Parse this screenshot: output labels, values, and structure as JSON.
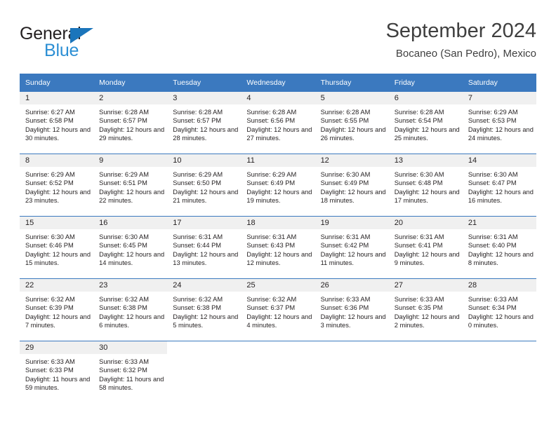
{
  "brand": {
    "name_top": "General",
    "name_bottom": "Blue"
  },
  "header": {
    "title": "September 2024",
    "subtitle": "Bocaneo (San Pedro), Mexico"
  },
  "colors": {
    "header_blue": "#3b79bf",
    "brand_blue": "#1b75bb",
    "brand_blue_light": "#2c8fd4",
    "day_band": "#f0f0f0",
    "text": "#231f20"
  },
  "weekdays": [
    "Sunday",
    "Monday",
    "Tuesday",
    "Wednesday",
    "Thursday",
    "Friday",
    "Saturday"
  ],
  "labels": {
    "sunrise_prefix": "Sunrise:",
    "sunset_prefix": "Sunset:",
    "daylight_prefix": "Daylight:"
  },
  "weeks": [
    [
      {
        "day": "1",
        "sunrise": "Sunrise: 6:27 AM",
        "sunset": "Sunset: 6:58 PM",
        "daylight": "Daylight: 12 hours and 30 minutes."
      },
      {
        "day": "2",
        "sunrise": "Sunrise: 6:28 AM",
        "sunset": "Sunset: 6:57 PM",
        "daylight": "Daylight: 12 hours and 29 minutes."
      },
      {
        "day": "3",
        "sunrise": "Sunrise: 6:28 AM",
        "sunset": "Sunset: 6:57 PM",
        "daylight": "Daylight: 12 hours and 28 minutes."
      },
      {
        "day": "4",
        "sunrise": "Sunrise: 6:28 AM",
        "sunset": "Sunset: 6:56 PM",
        "daylight": "Daylight: 12 hours and 27 minutes."
      },
      {
        "day": "5",
        "sunrise": "Sunrise: 6:28 AM",
        "sunset": "Sunset: 6:55 PM",
        "daylight": "Daylight: 12 hours and 26 minutes."
      },
      {
        "day": "6",
        "sunrise": "Sunrise: 6:28 AM",
        "sunset": "Sunset: 6:54 PM",
        "daylight": "Daylight: 12 hours and 25 minutes."
      },
      {
        "day": "7",
        "sunrise": "Sunrise: 6:29 AM",
        "sunset": "Sunset: 6:53 PM",
        "daylight": "Daylight: 12 hours and 24 minutes."
      }
    ],
    [
      {
        "day": "8",
        "sunrise": "Sunrise: 6:29 AM",
        "sunset": "Sunset: 6:52 PM",
        "daylight": "Daylight: 12 hours and 23 minutes."
      },
      {
        "day": "9",
        "sunrise": "Sunrise: 6:29 AM",
        "sunset": "Sunset: 6:51 PM",
        "daylight": "Daylight: 12 hours and 22 minutes."
      },
      {
        "day": "10",
        "sunrise": "Sunrise: 6:29 AM",
        "sunset": "Sunset: 6:50 PM",
        "daylight": "Daylight: 12 hours and 21 minutes."
      },
      {
        "day": "11",
        "sunrise": "Sunrise: 6:29 AM",
        "sunset": "Sunset: 6:49 PM",
        "daylight": "Daylight: 12 hours and 19 minutes."
      },
      {
        "day": "12",
        "sunrise": "Sunrise: 6:30 AM",
        "sunset": "Sunset: 6:49 PM",
        "daylight": "Daylight: 12 hours and 18 minutes."
      },
      {
        "day": "13",
        "sunrise": "Sunrise: 6:30 AM",
        "sunset": "Sunset: 6:48 PM",
        "daylight": "Daylight: 12 hours and 17 minutes."
      },
      {
        "day": "14",
        "sunrise": "Sunrise: 6:30 AM",
        "sunset": "Sunset: 6:47 PM",
        "daylight": "Daylight: 12 hours and 16 minutes."
      }
    ],
    [
      {
        "day": "15",
        "sunrise": "Sunrise: 6:30 AM",
        "sunset": "Sunset: 6:46 PM",
        "daylight": "Daylight: 12 hours and 15 minutes."
      },
      {
        "day": "16",
        "sunrise": "Sunrise: 6:30 AM",
        "sunset": "Sunset: 6:45 PM",
        "daylight": "Daylight: 12 hours and 14 minutes."
      },
      {
        "day": "17",
        "sunrise": "Sunrise: 6:31 AM",
        "sunset": "Sunset: 6:44 PM",
        "daylight": "Daylight: 12 hours and 13 minutes."
      },
      {
        "day": "18",
        "sunrise": "Sunrise: 6:31 AM",
        "sunset": "Sunset: 6:43 PM",
        "daylight": "Daylight: 12 hours and 12 minutes."
      },
      {
        "day": "19",
        "sunrise": "Sunrise: 6:31 AM",
        "sunset": "Sunset: 6:42 PM",
        "daylight": "Daylight: 12 hours and 11 minutes."
      },
      {
        "day": "20",
        "sunrise": "Sunrise: 6:31 AM",
        "sunset": "Sunset: 6:41 PM",
        "daylight": "Daylight: 12 hours and 9 minutes."
      },
      {
        "day": "21",
        "sunrise": "Sunrise: 6:31 AM",
        "sunset": "Sunset: 6:40 PM",
        "daylight": "Daylight: 12 hours and 8 minutes."
      }
    ],
    [
      {
        "day": "22",
        "sunrise": "Sunrise: 6:32 AM",
        "sunset": "Sunset: 6:39 PM",
        "daylight": "Daylight: 12 hours and 7 minutes."
      },
      {
        "day": "23",
        "sunrise": "Sunrise: 6:32 AM",
        "sunset": "Sunset: 6:38 PM",
        "daylight": "Daylight: 12 hours and 6 minutes."
      },
      {
        "day": "24",
        "sunrise": "Sunrise: 6:32 AM",
        "sunset": "Sunset: 6:38 PM",
        "daylight": "Daylight: 12 hours and 5 minutes."
      },
      {
        "day": "25",
        "sunrise": "Sunrise: 6:32 AM",
        "sunset": "Sunset: 6:37 PM",
        "daylight": "Daylight: 12 hours and 4 minutes."
      },
      {
        "day": "26",
        "sunrise": "Sunrise: 6:33 AM",
        "sunset": "Sunset: 6:36 PM",
        "daylight": "Daylight: 12 hours and 3 minutes."
      },
      {
        "day": "27",
        "sunrise": "Sunrise: 6:33 AM",
        "sunset": "Sunset: 6:35 PM",
        "daylight": "Daylight: 12 hours and 2 minutes."
      },
      {
        "day": "28",
        "sunrise": "Sunrise: 6:33 AM",
        "sunset": "Sunset: 6:34 PM",
        "daylight": "Daylight: 12 hours and 0 minutes."
      }
    ],
    [
      {
        "day": "29",
        "sunrise": "Sunrise: 6:33 AM",
        "sunset": "Sunset: 6:33 PM",
        "daylight": "Daylight: 11 hours and 59 minutes."
      },
      {
        "day": "30",
        "sunrise": "Sunrise: 6:33 AM",
        "sunset": "Sunset: 6:32 PM",
        "daylight": "Daylight: 11 hours and 58 minutes."
      },
      {
        "day": "",
        "sunrise": "",
        "sunset": "",
        "daylight": ""
      },
      {
        "day": "",
        "sunrise": "",
        "sunset": "",
        "daylight": ""
      },
      {
        "day": "",
        "sunrise": "",
        "sunset": "",
        "daylight": ""
      },
      {
        "day": "",
        "sunrise": "",
        "sunset": "",
        "daylight": ""
      },
      {
        "day": "",
        "sunrise": "",
        "sunset": "",
        "daylight": ""
      }
    ]
  ]
}
